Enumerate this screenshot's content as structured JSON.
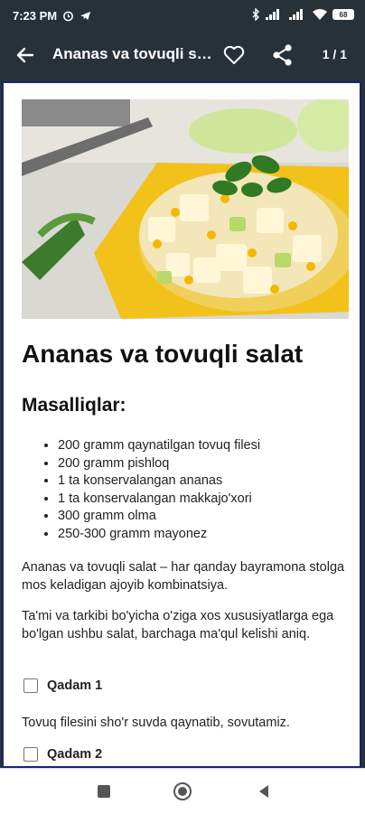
{
  "status": {
    "time": "7:23 PM",
    "battery": "68"
  },
  "appbar": {
    "title": "Ananas va tovuqli salat",
    "pager": "1 / 1"
  },
  "recipe": {
    "title": "Ananas va tovuqli salat",
    "ingredients_heading": "Masalliqlar:",
    "ingredients": [
      "200 gramm qaynatilgan tovuq filesi",
      "200 gramm pishloq",
      "1 ta konservalangan ananas",
      "1 ta konservalangan makkajo'xori",
      "300 gramm olma",
      "250-300 gramm mayonez"
    ],
    "intro_1": "Ananas va tovuqli salat – har qanday bayramona stolga mos keladigan ajoyib kombinatsiya.",
    "intro_2": "Ta'mi va tarkibi bo'yicha o'ziga xos xususiyatlarga ega bo'lgan ushbu salat, barchaga ma'qul kelishi aniq.",
    "steps": [
      {
        "label": "Qadam 1",
        "text": "Tovuq filesini sho'r suvda qaynatib, sovutamiz."
      },
      {
        "label": "Qadam 2"
      }
    ]
  },
  "colors": {
    "appbar_bg": "#263238",
    "content_border": "#1a2472",
    "plate": "#f2c21b"
  },
  "icons": {
    "back": "arrow-left",
    "favorite": "heart-outline",
    "share": "share",
    "nav_recents": "square",
    "nav_home": "circle",
    "nav_back": "triangle-left"
  }
}
